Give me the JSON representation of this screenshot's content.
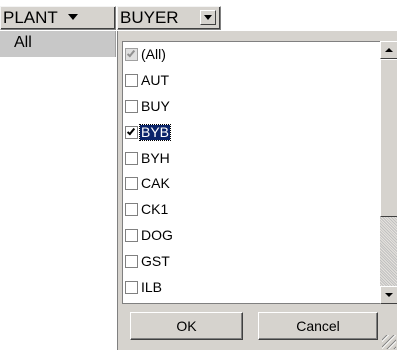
{
  "headers": {
    "plant": {
      "label": "PLANT",
      "icon": "dropdown-arrow-icon"
    },
    "buyer": {
      "label": "BUYER",
      "icon": "dropdown-button-icon"
    }
  },
  "plant_value": "All",
  "buyer_filter": {
    "items": [
      {
        "label": "(All)",
        "checked": true,
        "state": "grey"
      },
      {
        "label": "AUT",
        "checked": false
      },
      {
        "label": "BUY",
        "checked": false
      },
      {
        "label": "BYB",
        "checked": true,
        "selected": true
      },
      {
        "label": "BYH",
        "checked": false
      },
      {
        "label": "CAK",
        "checked": false
      },
      {
        "label": "CK1",
        "checked": false
      },
      {
        "label": "DOG",
        "checked": false
      },
      {
        "label": "GST",
        "checked": false
      },
      {
        "label": "ILB",
        "checked": false
      }
    ],
    "ok_label": "OK",
    "cancel_label": "Cancel"
  },
  "colors": {
    "face": "#d6d3ce",
    "selection": "#0a246a",
    "cell": "#c8c8c8"
  }
}
